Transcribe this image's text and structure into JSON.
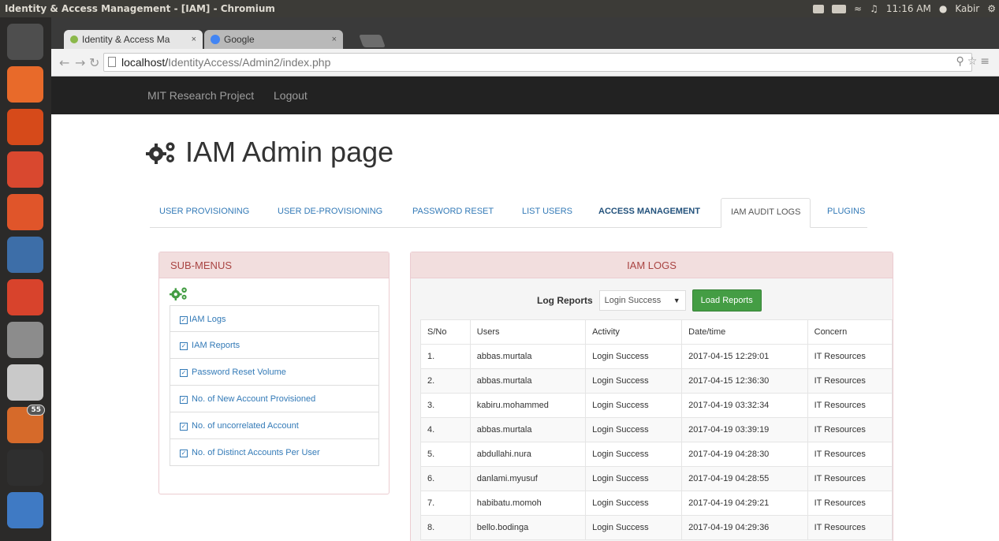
{
  "window": {
    "title": "Identity & Access Management - [IAM] - Chromium",
    "tray": {
      "time": "11:16 AM",
      "user": "Kabir"
    }
  },
  "browser": {
    "tabs": [
      {
        "label": "Identity & Access Ma",
        "close": "×"
      },
      {
        "label": "Google",
        "close": "×"
      }
    ],
    "url_host": "localhost/",
    "url_path": "IdentityAccess/Admin2/index.php"
  },
  "launcher": {
    "items": [
      {
        "name": "ubuntu-dash-icon",
        "color": "#4e4e4e"
      },
      {
        "name": "files-icon",
        "color": "#e86a2a"
      },
      {
        "name": "firefox-icon",
        "color": "#d64a1a"
      },
      {
        "name": "mail-icon",
        "color": "#d9482f"
      },
      {
        "name": "ubuntu-software-icon",
        "color": "#e0552a"
      },
      {
        "name": "writer-icon",
        "color": "#3d6ea8"
      },
      {
        "name": "settings-icon",
        "color": "#d8432c"
      },
      {
        "name": "documents-icon",
        "color": "#8c8c8c"
      },
      {
        "name": "pdf-viewer-icon",
        "color": "#c9c9c9"
      },
      {
        "name": "software-updater-icon",
        "color": "#d66a2a",
        "badge": "55"
      },
      {
        "name": "terminal-icon",
        "color": "#2f2f2f"
      },
      {
        "name": "chromium-icon",
        "color": "#3f7ac4"
      }
    ]
  },
  "navbar": {
    "brand": "MIT Research Project",
    "logout": "Logout"
  },
  "page": {
    "title": "IAM Admin page"
  },
  "tabs": [
    {
      "label": "USER PROVISIONING"
    },
    {
      "label": "USER DE-PROVISIONING"
    },
    {
      "label": "PASSWORD RESET"
    },
    {
      "label": "LIST USERS"
    },
    {
      "label": "ACCESS MANAGEMENT"
    },
    {
      "label": "IAM AUDIT LOGS"
    },
    {
      "label": "PLUGINS"
    }
  ],
  "submenu": {
    "heading": "SUB-MENUS",
    "items": [
      "IAM Logs",
      " IAM Reports",
      " Password Reset Volume",
      " No. of New Account Provisioned",
      " No. of uncorrelated Account",
      " No. of Distinct Accounts Per User"
    ]
  },
  "logs": {
    "heading": "IAM LOGS",
    "report_label": "Log Reports",
    "report_value": "Login Success",
    "load_button": "Load Reports",
    "columns": [
      "S/No",
      "Users",
      "Activity",
      "Date/time",
      "Concern"
    ],
    "rows": [
      [
        "1.",
        "abbas.murtala",
        "Login Success",
        "2017-04-15 12:29:01",
        "IT Resources"
      ],
      [
        "2.",
        "abbas.murtala",
        "Login Success",
        "2017-04-15 12:36:30",
        "IT Resources"
      ],
      [
        "3.",
        "kabiru.mohammed",
        "Login Success",
        "2017-04-19 03:32:34",
        "IT Resources"
      ],
      [
        "4.",
        "abbas.murtala",
        "Login Success",
        "2017-04-19 03:39:19",
        "IT Resources"
      ],
      [
        "5.",
        "abdullahi.nura",
        "Login Success",
        "2017-04-19 04:28:30",
        "IT Resources"
      ],
      [
        "6.",
        "danlami.myusuf",
        "Login Success",
        "2017-04-19 04:28:55",
        "IT Resources"
      ],
      [
        "7.",
        "habibatu.momoh",
        "Login Success",
        "2017-04-19 04:29:21",
        "IT Resources"
      ],
      [
        "8.",
        "bello.bodinga",
        "Login Success",
        "2017-04-19 04:29:36",
        "IT Resources"
      ]
    ]
  }
}
